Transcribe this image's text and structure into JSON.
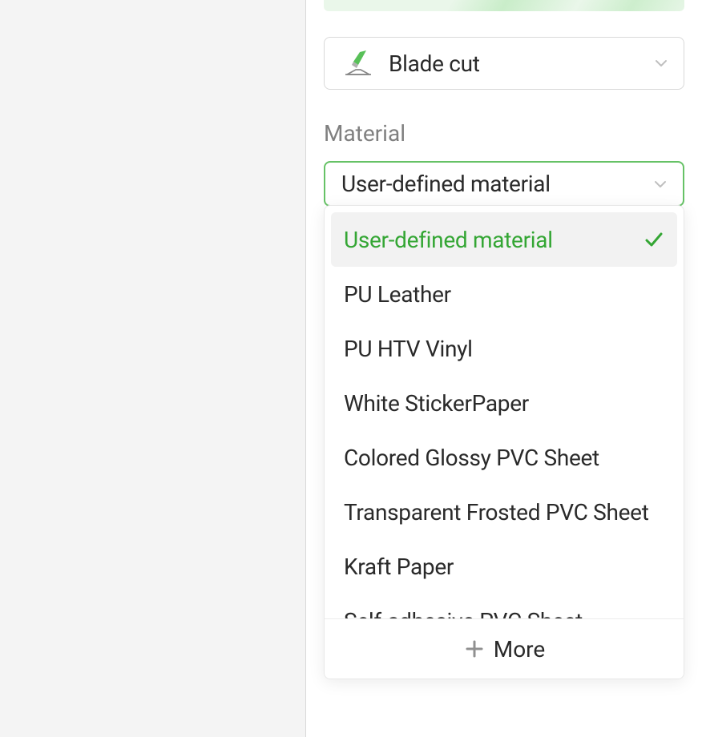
{
  "blade": {
    "label": "Blade cut"
  },
  "material": {
    "section_label": "Material",
    "selected_value": "User-defined material"
  },
  "dropdown": {
    "items": [
      {
        "label": "User-defined material",
        "selected": true
      },
      {
        "label": "PU Leather",
        "selected": false
      },
      {
        "label": "PU HTV Vinyl",
        "selected": false
      },
      {
        "label": "White StickerPaper",
        "selected": false
      },
      {
        "label": "Colored Glossy PVC Sheet",
        "selected": false
      },
      {
        "label": "Transparent Frosted PVC Sheet",
        "selected": false
      },
      {
        "label": "Kraft Paper",
        "selected": false
      },
      {
        "label": "Self-adhesive PVC Sheet",
        "selected": false
      }
    ],
    "more_label": "More"
  },
  "colors": {
    "accent": "#34a634",
    "border_active": "#66c266"
  }
}
